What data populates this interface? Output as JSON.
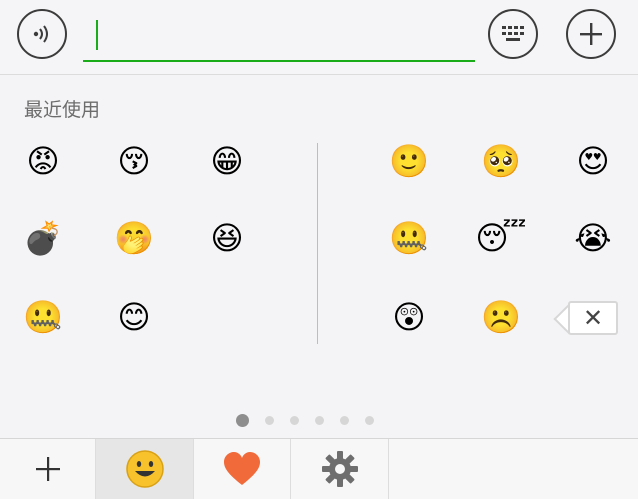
{
  "input": {
    "value": ""
  },
  "recent_label": "最近使用",
  "recent_emojis": [
    "😡",
    "😚",
    "😁",
    "💣",
    "🤭",
    "😆",
    "🤐",
    "😊"
  ],
  "page_emojis": [
    "🙂",
    "🥺",
    "😍",
    "🤐",
    "😴",
    "😭",
    "😲",
    "☹️"
  ],
  "backspace_icon": "✕",
  "pager": {
    "pages": 6,
    "active": 1
  },
  "bottom_tabs": [
    {
      "name": "add-icon",
      "glyph": "+"
    },
    {
      "name": "emoji-icon",
      "glyph": "😀"
    },
    {
      "name": "heart-icon",
      "glyph": "❤"
    },
    {
      "name": "settings-icon",
      "glyph": "⚙"
    }
  ],
  "colors": {
    "accent": "#1aad19"
  }
}
